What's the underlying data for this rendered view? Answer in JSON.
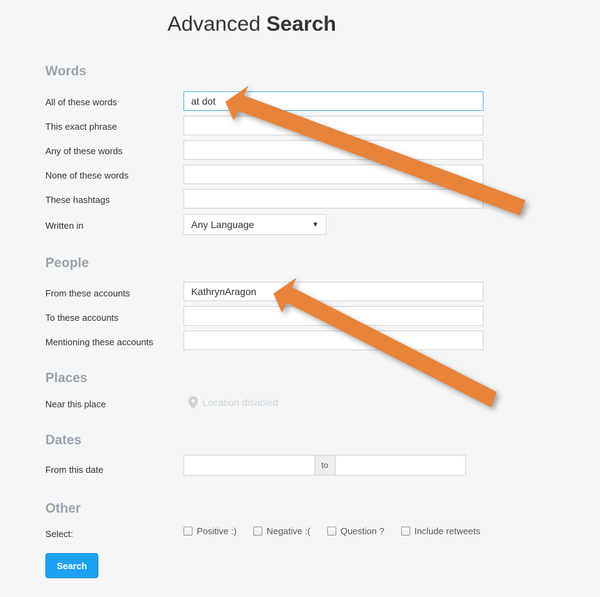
{
  "title": {
    "thin": "Advanced ",
    "bold": "Search"
  },
  "sections": {
    "words": "Words",
    "people": "People",
    "places": "Places",
    "dates": "Dates",
    "other": "Other"
  },
  "words": {
    "all_label": "All of these words",
    "all_value": "at dot",
    "exact_label": "This exact phrase",
    "exact_value": "",
    "any_label": "Any of these words",
    "any_value": "",
    "none_label": "None of these words",
    "none_value": "",
    "hashtags_label": "These hashtags",
    "hashtags_value": "",
    "lang_label": "Written in",
    "lang_value": "Any Language"
  },
  "people": {
    "from_label": "From these accounts",
    "from_value": "KathrynAragon",
    "to_label": "To these accounts",
    "to_value": "",
    "mention_label": "Mentioning these accounts",
    "mention_value": ""
  },
  "places": {
    "near_label": "Near this place",
    "disabled_text": "Location disabled"
  },
  "dates": {
    "from_label": "From this date",
    "separator": "to"
  },
  "other": {
    "select_label": "Select:",
    "positive": "Positive :)",
    "negative": "Negative :(",
    "question": "Question ?",
    "retweets": "Include retweets"
  },
  "search_button": "Search"
}
